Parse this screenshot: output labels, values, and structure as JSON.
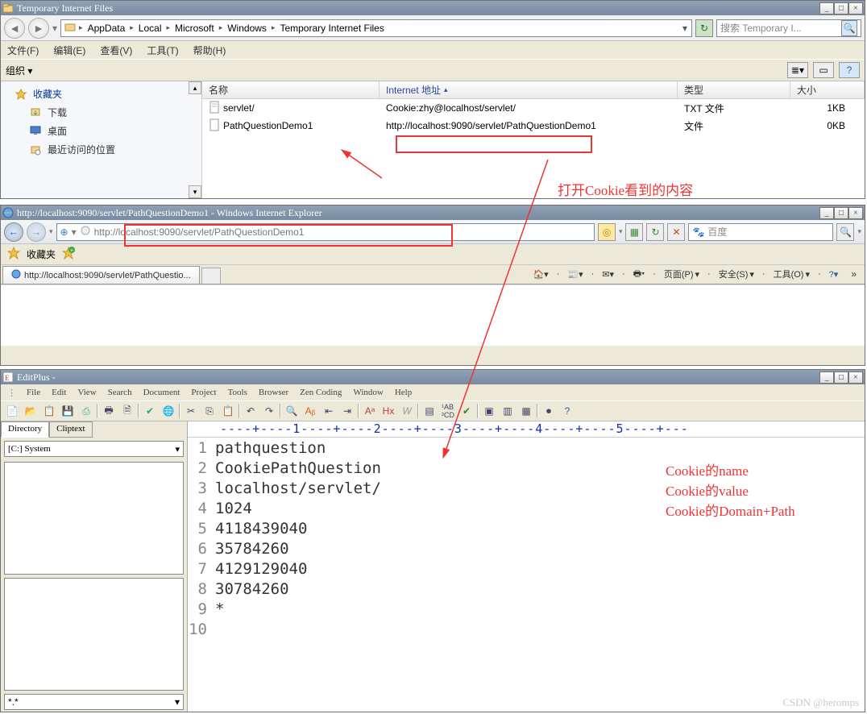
{
  "win1": {
    "title": "Temporary Internet Files",
    "breadcrumb": [
      "AppData",
      "Local",
      "Microsoft",
      "Windows",
      "Temporary Internet Files"
    ],
    "search_placeholder": "搜索 Temporary I...",
    "menu": {
      "file": "文件(F)",
      "edit": "编辑(E)",
      "view": "查看(V)",
      "tools": "工具(T)",
      "help": "帮助(H)"
    },
    "organize": "组织 ▾",
    "tree": {
      "fav": "收藏夹",
      "downloads": "下载",
      "desktop": "桌面",
      "recent": "最近访问的位置"
    },
    "columns": {
      "name": "名称",
      "addr": "Internet 地址",
      "type": "类型",
      "size": "大小"
    },
    "rows": [
      {
        "name": "servlet/",
        "addr": "Cookie:zhy@localhost/servlet/",
        "type": "TXT 文件",
        "size": "1KB"
      },
      {
        "name": "PathQuestionDemo1",
        "addr": "http://localhost:9090/servlet/PathQuestionDemo1",
        "type": "文件",
        "size": "0KB"
      }
    ]
  },
  "win2": {
    "title": "http://localhost:9090/servlet/PathQuestionDemo1 - Windows Internet Explorer",
    "url": "http://localhost:9090/servlet/PathQuestionDemo1",
    "search_hint": "百度",
    "fav_label": "收藏夹",
    "tab_label": "http://localhost:9090/servlet/PathQuestio...",
    "tools": {
      "home": "",
      "rss": "",
      "mail": "",
      "print": "",
      "page": "页面(P)",
      "safety": "安全(S)",
      "tools": "工具(O)"
    }
  },
  "win3": {
    "title": "EditPlus -",
    "menu": [
      "File",
      "Edit",
      "View",
      "Search",
      "Document",
      "Project",
      "Tools",
      "Browser",
      "Zen Coding",
      "Window",
      "Help"
    ],
    "side_tabs": {
      "dir": "Directory",
      "clip": "Cliptext"
    },
    "drive": "[C:] System",
    "filter": "*.*",
    "ruler": "----+----1----+----2----+----3----+----4----+----5----+---",
    "lines": [
      "pathquestion",
      "CookiePathQuestion",
      "localhost/servlet/",
      "1024",
      "4118439040",
      "35784260",
      "4129129040",
      "30784260",
      "*",
      ""
    ]
  },
  "annotations": {
    "openCookie": "打开Cookie看到的内容",
    "name": "Cookie的name",
    "value": "Cookie的value",
    "domain": "Cookie的Domain+Path"
  },
  "watermark": "CSDN @heromps"
}
